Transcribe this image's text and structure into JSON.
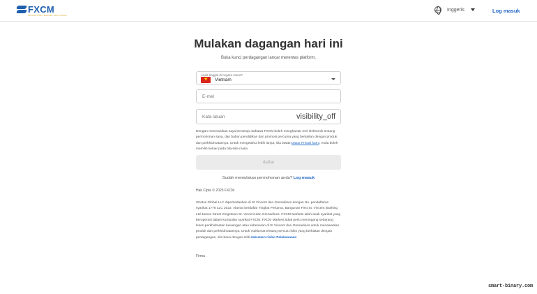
{
  "header": {
    "logo_text": "FXCM",
    "logo_tagline": "INNOVATIVE TRADING SOLUTIONS",
    "language": "Inggeris",
    "login": "Log masuk"
  },
  "main": {
    "title": "Mulakan dagangan hari ini",
    "subtitle": "Buka kunci perdagangan lancar merentas platform.",
    "country": {
      "label": "Anda tinggal di negara mana?",
      "value": "Vietnam"
    },
    "email_placeholder": "E-mel",
    "password_placeholder": "Kata laluan",
    "password_toggle": "visibility_off",
    "consent_before": "Dengan menerusikan saya bersetuju bahawa FXCM boleh menghantar mel elektronik tentang permohonan saya, dan bahan pendidikan dan promosi percuma yang berkaitan dengan produk dan perkhidmatannya. Untuk mengetahui lebih lanjut, sila lawati ",
    "consent_link": "Dasar Privasi kami",
    "consent_after": ". Anda boleh memilih keluar pada bila-bila masa.",
    "submit": "daftar",
    "already_text": "Sudah memulakan permohonan anda?",
    "already_link": "Log masuk",
    "copyright": "Hak Cipta © 2025 FXCM",
    "legal_before": "Stratos Global LLC diperbadankan di St Vincent dan Grenadines dengan No. pendaftaran syarikat 1776 LLC 2022. Alamat berdaftar Tingkat Pertama, Bangunan First St. Vincent Banking Ltd James Street Kingstown St. Vincent dan Grenadines. FXCM Markets ialah anak syarikat yang beroperasi dalam kumpulan syarikat FXCM. FXCM Markets tidak perlu memegang sebarang lesen perkhidmatan kewangan atau kebenaran di St Vincent dan Grenadines untuk menawarkan produk dan perkhidmatannya. Untuk maklumat tentang semua risiko yang berkaitan dengan perdagangan, sila baca dengan teliti ",
    "legal_link": "dokumen risiko Pelaksanaan",
    "firma": "Firma ."
  },
  "watermark": "smart-binary.com",
  "colors": {
    "brand": "#1f5fae",
    "link": "#1f66c4",
    "button_disabled": "#ebebeb"
  }
}
